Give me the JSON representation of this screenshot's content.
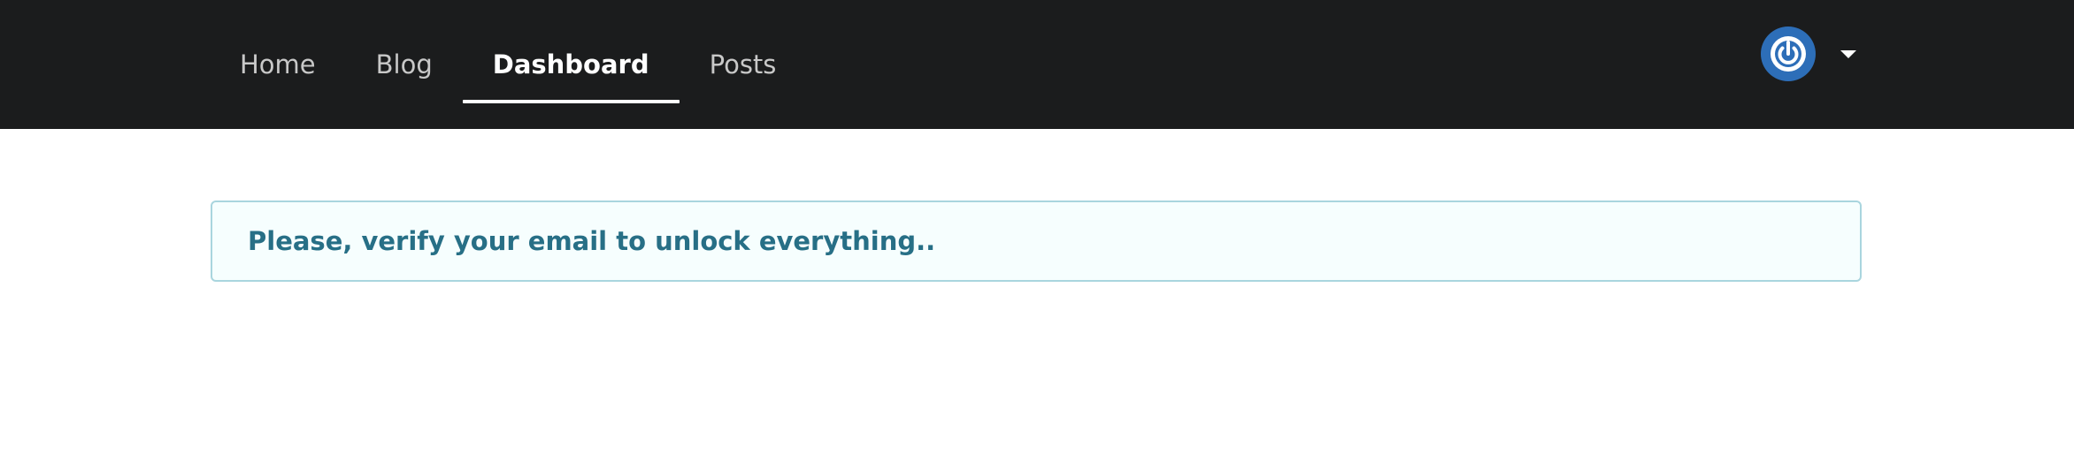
{
  "navbar": {
    "items": [
      {
        "label": "Home",
        "active": false
      },
      {
        "label": "Blog",
        "active": false
      },
      {
        "label": "Dashboard",
        "active": true
      },
      {
        "label": "Posts",
        "active": false
      }
    ],
    "user": {
      "avatar_icon": "power-icon",
      "dropdown_icon": "caret-down-icon"
    }
  },
  "message": {
    "text": "Please, verify your email to unlock everything.."
  },
  "colors": {
    "navbar_bg": "#1b1c1d",
    "avatar_bg": "#2d6eb8",
    "message_bg": "#f6fefe",
    "message_border": "#a9d5de",
    "message_text": "#276f86"
  }
}
